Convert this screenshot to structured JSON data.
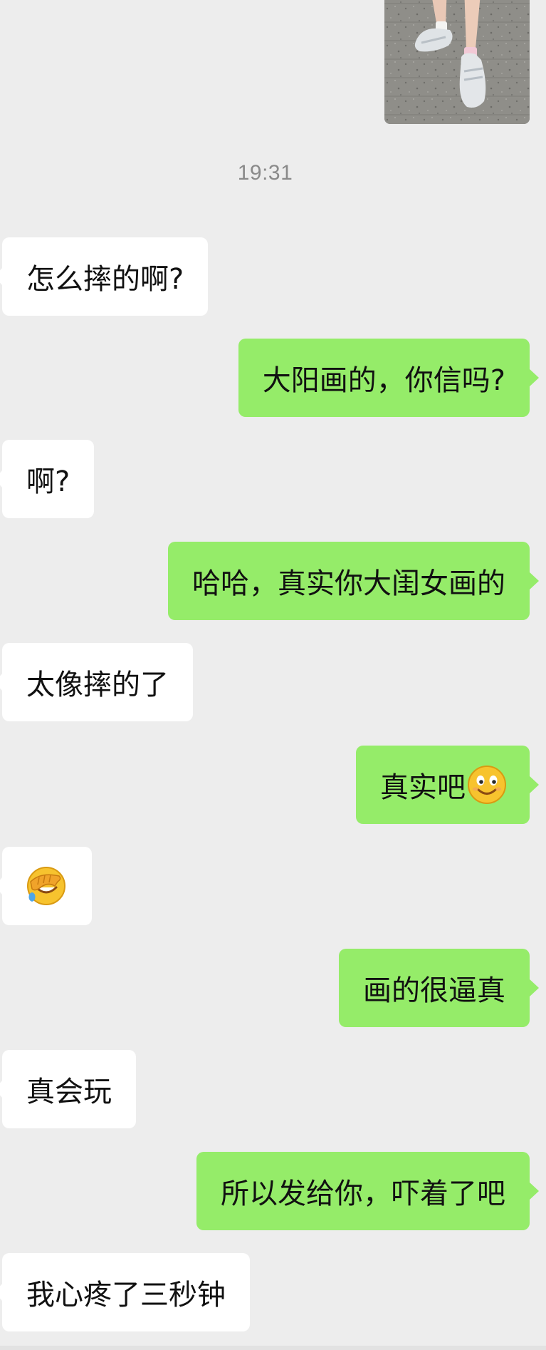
{
  "timestamp": "19:31",
  "messages": [
    {
      "side": "in",
      "text": "怎么摔的啊?"
    },
    {
      "side": "out",
      "text": "大阳画的，你信吗?"
    },
    {
      "side": "in",
      "text": "啊?"
    },
    {
      "side": "out",
      "text": "哈哈，真实你大闺女画的"
    },
    {
      "side": "in",
      "text": "太像摔的了"
    },
    {
      "side": "out",
      "text": "真实吧",
      "emoji": "smile-emoji"
    },
    {
      "side": "in",
      "text": "",
      "emoji": "facepalm-emoji"
    },
    {
      "side": "out",
      "text": "画的很逼真"
    },
    {
      "side": "in",
      "text": "真会玩"
    },
    {
      "side": "out",
      "text": "所以发给你，吓着了吧"
    },
    {
      "side": "in",
      "text": "我心疼了三秒钟"
    }
  ],
  "colors": {
    "background": "#ededed",
    "incoming_bubble": "#ffffff",
    "outgoing_bubble": "#95ec69",
    "timestamp_text": "#8a8a8a"
  }
}
